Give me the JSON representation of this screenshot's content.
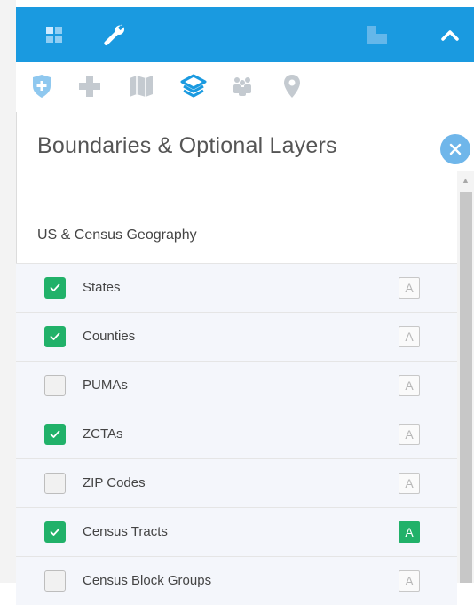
{
  "topbar": {
    "layout_icon": "grid-icon",
    "tools_icon": "wrench-icon",
    "window_icon": "window-icon",
    "collapse_icon": "chevron-up-icon",
    "color": "#1a9ae0"
  },
  "toolbar": {
    "tools": [
      {
        "name": "shield-plus-icon",
        "active": false
      },
      {
        "name": "plus-icon",
        "active": false
      },
      {
        "name": "map-icon",
        "active": false
      },
      {
        "name": "layers-icon",
        "active": true
      },
      {
        "name": "people-icon",
        "active": false
      },
      {
        "name": "location-pin-icon",
        "active": false
      }
    ]
  },
  "panel": {
    "title": "Boundaries & Optional Layers",
    "close_icon": "close-icon",
    "section": "US & Census Geography",
    "rows": [
      {
        "label": "States",
        "checked": true,
        "label_badge": "A",
        "badge_active": false
      },
      {
        "label": "Counties",
        "checked": true,
        "label_badge": "A",
        "badge_active": false
      },
      {
        "label": "PUMAs",
        "checked": false,
        "label_badge": "A",
        "badge_active": false
      },
      {
        "label": "ZCTAs",
        "checked": true,
        "label_badge": "A",
        "badge_active": false
      },
      {
        "label": "ZIP Codes",
        "checked": false,
        "label_badge": "A",
        "badge_active": false
      },
      {
        "label": "Census Tracts",
        "checked": true,
        "label_badge": "A",
        "badge_active": true
      },
      {
        "label": "Census Block Groups",
        "checked": false,
        "label_badge": "A",
        "badge_active": false
      }
    ]
  },
  "colors": {
    "checked": "#21b169",
    "active_tool": "#1a9ae0",
    "inactive_tool": "#c4cad0"
  }
}
